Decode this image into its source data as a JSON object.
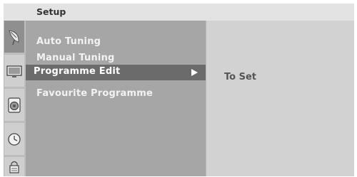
{
  "header": {
    "title": "Setup"
  },
  "sidebar": {
    "icons": [
      {
        "name": "satellite-icon",
        "active": true
      },
      {
        "name": "tv-picture-icon",
        "active": false
      },
      {
        "name": "speaker-audio-icon",
        "active": false
      },
      {
        "name": "clock-time-icon",
        "active": false
      },
      {
        "name": "lock-option-icon",
        "active": false
      }
    ]
  },
  "menu": {
    "items": [
      {
        "label": "Auto Tuning"
      },
      {
        "label": "Manual Tuning"
      },
      {
        "label": "Programme Edit",
        "selected": true
      },
      {
        "label": "Favourite Programme"
      }
    ]
  },
  "submenu": {
    "items": [
      {
        "label": "To Set"
      }
    ]
  },
  "colors": {
    "title_bar": "#e3e3e3",
    "menu_bg": "#a6a6a6",
    "selection": "#6b6b6b",
    "submenu_bg": "#d2d2d2"
  }
}
